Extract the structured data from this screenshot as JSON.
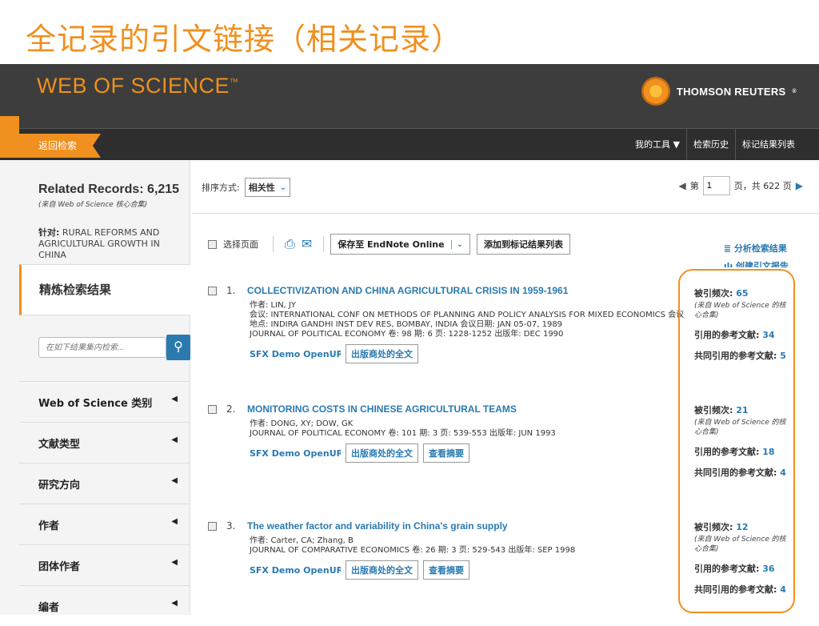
{
  "slide": {
    "title": "全记录的引文链接（相关记录）"
  },
  "header": {
    "logo": "WEB OF SCIENCE",
    "logo_tm": "™",
    "partner": "THOMSON REUTERS",
    "partner_reg": "®"
  },
  "nav": {
    "back": "返回检索",
    "my_tools": "我的工具",
    "history": "检索历史",
    "marked": "标记结果列表"
  },
  "sidebar": {
    "related_title": "Related Records: 6,215",
    "related_source": "(来自 Web of Science 核心合集)",
    "target_label": "针对:",
    "target_value": "RURAL REFORMS AND AGRICULTURAL GROWTH IN CHINA",
    "refine": "精炼检索结果",
    "search_placeholder": "在如下结果集内检索...",
    "facets": [
      "Web of Science 类别",
      "文献类型",
      "研究方向",
      "作者",
      "团体作者",
      "编者"
    ]
  },
  "sort": {
    "label": "排序方式:",
    "value": "相关性"
  },
  "pager": {
    "prefix": "第",
    "page": "1",
    "suffix": "页，共 622 页"
  },
  "toolbar": {
    "select_page": "选择页面",
    "save_to": "保存至 EndNote Online",
    "add_marked": "添加到标记结果列表",
    "analyze": "分析检索结果",
    "citation_report": "创建引文报告"
  },
  "records": [
    {
      "num": "1.",
      "title": "COLLECTIVIZATION AND CHINA AGRICULTURAL CRISIS IN 1959-1961",
      "meta": [
        "作者: LIN, JY",
        "会议: INTERNATIONAL CONF ON METHODS OF PLANNING AND POLICY ANALYSIS FOR MIXED ECONOMICS 会议",
        "地点: INDIRA GANDHI INST DEV RES, BOMBAY, INDIA 会议日期: JAN 05-07, 1989",
        "JOURNAL OF POLITICAL ECONOMY  卷: 98  期: 6  页: 1228-1252  出版年: DEC 1990"
      ],
      "sfx": "SFX Demo OpenURL Li",
      "fulltext": "出版商处的全文",
      "abstract": "",
      "times_cited_label": "被引频次:",
      "times_cited": "65",
      "source": "(来自 Web of Science 的核心合集)",
      "refs_label": "引用的参考文献:",
      "refs": "34",
      "shared_label": "共同引用的参考文献:",
      "shared": "5"
    },
    {
      "num": "2.",
      "title": "MONITORING COSTS IN CHINESE AGRICULTURAL TEAMS",
      "meta": [
        "作者: DONG, XY; DOW, GK",
        "JOURNAL OF POLITICAL ECONOMY  卷: 101  期: 3  页: 539-553  出版年: JUN 1993"
      ],
      "sfx": "SFX Demo OpenURL Li",
      "fulltext": "出版商处的全文",
      "abstract": "查看摘要",
      "times_cited_label": "被引频次:",
      "times_cited": "21",
      "source": "(来自 Web of Science 的核心合集)",
      "refs_label": "引用的参考文献:",
      "refs": "18",
      "shared_label": "共同引用的参考文献:",
      "shared": "4"
    },
    {
      "num": "3.",
      "title": "The weather factor and variability in China's grain supply",
      "meta": [
        "作者: Carter, CA; Zhang, B",
        "JOURNAL OF COMPARATIVE ECONOMICS  卷: 26  期: 3  页: 529-543  出版年: SEP 1998"
      ],
      "sfx": "SFX Demo OpenURL Li",
      "fulltext": "出版商处的全文",
      "abstract": "查看摘要",
      "times_cited_label": "被引频次:",
      "times_cited": "12",
      "source": "(来自 Web of Science 的核心合集)",
      "refs_label": "引用的参考文献:",
      "refs": "36",
      "shared_label": "共同引用的参考文献:",
      "shared": "4"
    }
  ],
  "colors": {
    "accent": "#f0901e",
    "link": "#2a7ab0",
    "header": "#3d3d3d"
  }
}
